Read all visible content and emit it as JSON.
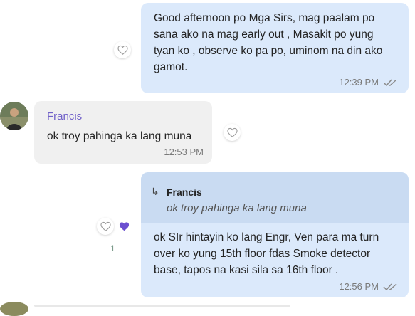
{
  "messages": [
    {
      "text": "Good afternoon po Mga Sirs, mag paalam po\nsana ako na mag early out , Masakit po yung\ntyan ko , observe ko pa po, uminom na din ako\ngamot.",
      "time": "12:39 PM"
    },
    {
      "sender": "Francis",
      "text": "ok troy pahinga ka lang muna",
      "time": "12:53 PM"
    },
    {
      "quote_sender": "Francis",
      "quote_text": "ok troy pahinga ka lang muna",
      "text": "ok SIr hintayin ko lang Engr, Ven para ma turn\nover ko yung 15th floor fdas Smoke detector\nbase, tapos na kasi sila sa 16th floor .",
      "time": "12:56 PM",
      "reaction_count": "1"
    }
  ],
  "icons": {
    "reply_arrow": "↳",
    "heart": "heart-icon",
    "read_receipt": "double-check-icon"
  },
  "colors": {
    "outgoing_bubble": "#dbe9fb",
    "incoming_bubble": "#f0f0f0",
    "quote_bg": "#c9dbf2",
    "sender_name": "#7060c8",
    "reaction_heart": "#6b4fd0"
  }
}
